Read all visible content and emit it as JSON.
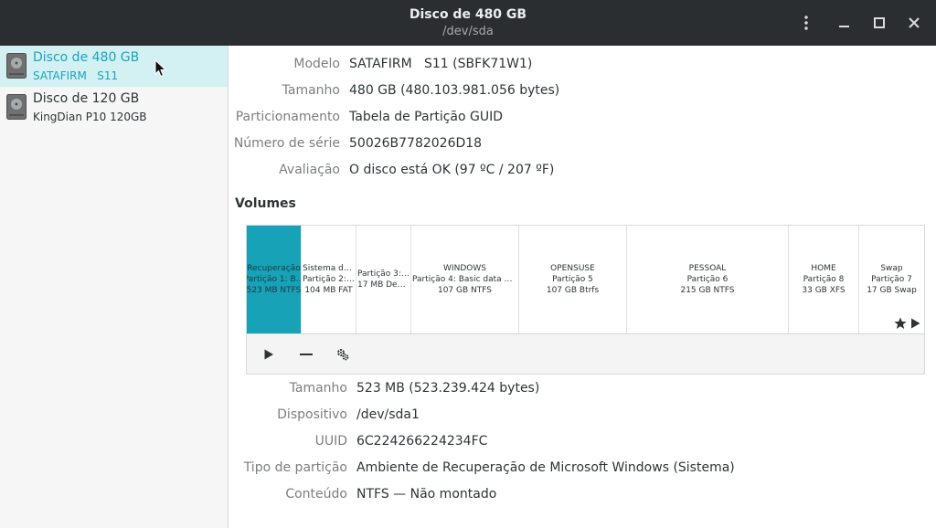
{
  "window": {
    "title": "Disco de 480 GB",
    "subtitle": "/dev/sda"
  },
  "header_buttons": {
    "menu_icon": "vertical-dots-icon",
    "minimize_icon": "minimize-icon",
    "maximize_icon": "maximize-icon",
    "close_icon": "close-icon"
  },
  "sidebar": {
    "drives": [
      {
        "name": "Disco de 480 GB",
        "model": "SATAFIRM   S11",
        "selected": true
      },
      {
        "name": "Disco de 120 GB",
        "model": "KingDian P10 120GB",
        "selected": false
      }
    ]
  },
  "disk_info": [
    {
      "label": "Modelo",
      "value": "SATAFIRM   S11 (SBFK71W1)"
    },
    {
      "label": "Tamanho",
      "value": "480 GB (480.103.981.056 bytes)"
    },
    {
      "label": "Particionamento",
      "value": "Tabela de Partição GUID"
    },
    {
      "label": "Número de série",
      "value": "50026B7782026D18"
    },
    {
      "label": "Avaliação",
      "value": "O disco está OK (97 ºC / 207 ºF)"
    }
  ],
  "volumes": {
    "title": "Volumes",
    "partitions": [
      {
        "l1": "Recuperação",
        "l2": "Partição 1: B...",
        "l3": "523 MB NTFS",
        "selected": true
      },
      {
        "l1": "Sistema de a...",
        "l2": "Partição 2: EF...",
        "l3": "104 MB FAT",
        "selected": false
      },
      {
        "l1": "Partição 3: Mi...",
        "l2": "17 MB Desco...",
        "l3": "",
        "selected": false
      },
      {
        "l1": "WINDOWS",
        "l2": "Partição 4: Basic data partiti...",
        "l3": "107 GB NTFS",
        "selected": false
      },
      {
        "l1": "OPENSUSE",
        "l2": "Partição 5",
        "l3": "107 GB Btrfs",
        "selected": false
      },
      {
        "l1": "PESSOAL",
        "l2": "Partição 6",
        "l3": "215 GB NTFS",
        "selected": false
      },
      {
        "l1": "HOME",
        "l2": "Partição 8",
        "l3": "33 GB XFS",
        "selected": false
      },
      {
        "l1": "Swap",
        "l2": "Partição 7",
        "l3": "17 GB Swap",
        "selected": false
      }
    ],
    "toolbar_icons": [
      "play-icon",
      "minus-icon",
      "gears-icon"
    ]
  },
  "partition_info": [
    {
      "label": "Tamanho",
      "value": "523 MB (523.239.424 bytes)"
    },
    {
      "label": "Dispositivo",
      "value": "/dev/sda1"
    },
    {
      "label": "UUID",
      "value": "6C224266224234FC"
    },
    {
      "label": "Tipo de partição",
      "value": "Ambiente de Recuperação de Microsoft Windows (Sistema)"
    },
    {
      "label": "Conteúdo",
      "value": "NTFS — Não montado"
    }
  ],
  "colors": {
    "accent": "#17a2b8",
    "selection_bg": "#d3f0f3",
    "headerbar": "#2b2e30"
  }
}
